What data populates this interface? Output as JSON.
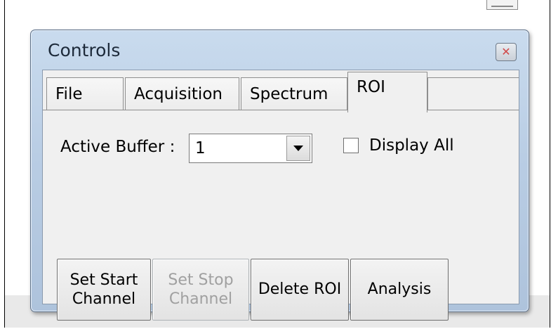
{
  "window": {
    "title": "Controls",
    "close_symbol": "✕"
  },
  "tabs": [
    {
      "label": "File",
      "active": false
    },
    {
      "label": "Acquisition",
      "active": false
    },
    {
      "label": "Spectrum",
      "active": false
    },
    {
      "label": "ROI",
      "active": true
    }
  ],
  "roi_panel": {
    "buffer_label": "Active Buffer :",
    "buffer_value": "1",
    "display_all_label": "Display All",
    "display_all_checked": false
  },
  "buttons": {
    "set_start": "Set Start\nChannel",
    "set_stop": "Set Stop\nChannel",
    "delete_roi": "Delete ROI",
    "analysis": "Analysis"
  },
  "icons": {
    "dropdown": "chevron-down-icon",
    "close": "close-icon"
  },
  "colors": {
    "title_bar": "#b9cde4",
    "close_glyph": "#d04848",
    "disabled_text": "#a0a0a0"
  }
}
